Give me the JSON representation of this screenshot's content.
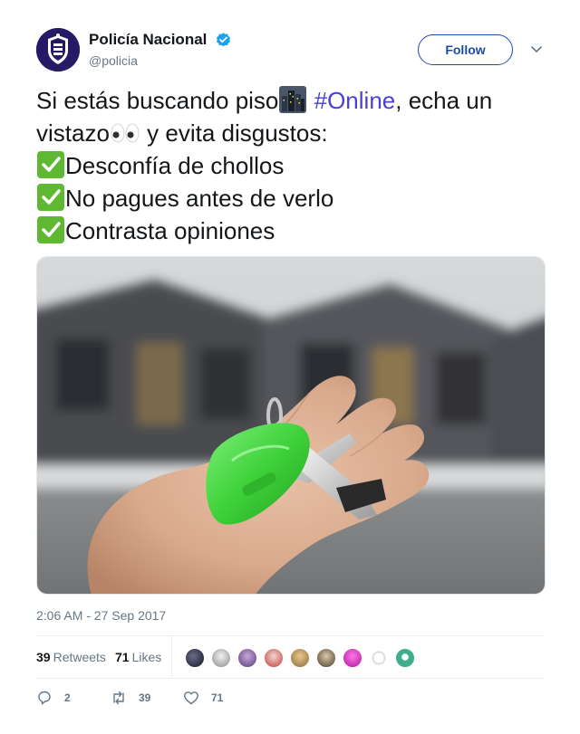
{
  "author": {
    "display_name": "Policía Nacional",
    "handle": "@policia",
    "verified": true,
    "avatar_icon": "police-shield-icon"
  },
  "follow_label": "Follow",
  "tweet": {
    "line1_a": "Si estás buscando piso",
    "line1_emoji": "cityscape-emoji",
    "line1_hashtag": "#Online",
    "line1_b": ", echa un",
    "line2_a": "vistazo",
    "line2_emoji": "eyes-emoji",
    "line2_b": " y evita disgustos:",
    "checklist": [
      {
        "icon": "check-mark-button-emoji",
        "text": "Desconfía de chollos"
      },
      {
        "icon": "check-mark-button-emoji",
        "text": "No pagues antes de verlo"
      },
      {
        "icon": "check-mark-button-emoji",
        "text": "Contrasta opiniones"
      }
    ]
  },
  "timestamp": "2:06 AM - 27 Sep 2017",
  "stats": {
    "retweets_count": "39",
    "retweets_label": "Retweets",
    "likes_count": "71",
    "likes_label": "Likes"
  },
  "actions": {
    "replies": "2",
    "retweets": "39",
    "likes": "71"
  },
  "colors": {
    "accent": "#1b4ab3",
    "hashtag": "#4b3fd4",
    "check_green": "#5fb832",
    "verified_blue": "#1da1f2"
  }
}
